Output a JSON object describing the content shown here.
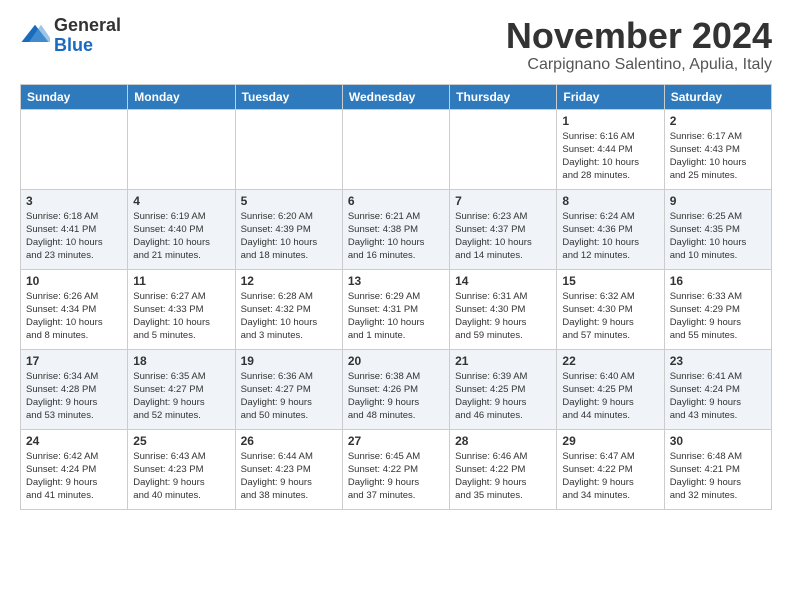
{
  "header": {
    "logo_line1": "General",
    "logo_line2": "Blue",
    "month": "November 2024",
    "location": "Carpignano Salentino, Apulia, Italy"
  },
  "weekdays": [
    "Sunday",
    "Monday",
    "Tuesday",
    "Wednesday",
    "Thursday",
    "Friday",
    "Saturday"
  ],
  "weeks": [
    [
      {
        "day": "",
        "info": ""
      },
      {
        "day": "",
        "info": ""
      },
      {
        "day": "",
        "info": ""
      },
      {
        "day": "",
        "info": ""
      },
      {
        "day": "",
        "info": ""
      },
      {
        "day": "1",
        "info": "Sunrise: 6:16 AM\nSunset: 4:44 PM\nDaylight: 10 hours\nand 28 minutes."
      },
      {
        "day": "2",
        "info": "Sunrise: 6:17 AM\nSunset: 4:43 PM\nDaylight: 10 hours\nand 25 minutes."
      }
    ],
    [
      {
        "day": "3",
        "info": "Sunrise: 6:18 AM\nSunset: 4:41 PM\nDaylight: 10 hours\nand 23 minutes."
      },
      {
        "day": "4",
        "info": "Sunrise: 6:19 AM\nSunset: 4:40 PM\nDaylight: 10 hours\nand 21 minutes."
      },
      {
        "day": "5",
        "info": "Sunrise: 6:20 AM\nSunset: 4:39 PM\nDaylight: 10 hours\nand 18 minutes."
      },
      {
        "day": "6",
        "info": "Sunrise: 6:21 AM\nSunset: 4:38 PM\nDaylight: 10 hours\nand 16 minutes."
      },
      {
        "day": "7",
        "info": "Sunrise: 6:23 AM\nSunset: 4:37 PM\nDaylight: 10 hours\nand 14 minutes."
      },
      {
        "day": "8",
        "info": "Sunrise: 6:24 AM\nSunset: 4:36 PM\nDaylight: 10 hours\nand 12 minutes."
      },
      {
        "day": "9",
        "info": "Sunrise: 6:25 AM\nSunset: 4:35 PM\nDaylight: 10 hours\nand 10 minutes."
      }
    ],
    [
      {
        "day": "10",
        "info": "Sunrise: 6:26 AM\nSunset: 4:34 PM\nDaylight: 10 hours\nand 8 minutes."
      },
      {
        "day": "11",
        "info": "Sunrise: 6:27 AM\nSunset: 4:33 PM\nDaylight: 10 hours\nand 5 minutes."
      },
      {
        "day": "12",
        "info": "Sunrise: 6:28 AM\nSunset: 4:32 PM\nDaylight: 10 hours\nand 3 minutes."
      },
      {
        "day": "13",
        "info": "Sunrise: 6:29 AM\nSunset: 4:31 PM\nDaylight: 10 hours\nand 1 minute."
      },
      {
        "day": "14",
        "info": "Sunrise: 6:31 AM\nSunset: 4:30 PM\nDaylight: 9 hours\nand 59 minutes."
      },
      {
        "day": "15",
        "info": "Sunrise: 6:32 AM\nSunset: 4:30 PM\nDaylight: 9 hours\nand 57 minutes."
      },
      {
        "day": "16",
        "info": "Sunrise: 6:33 AM\nSunset: 4:29 PM\nDaylight: 9 hours\nand 55 minutes."
      }
    ],
    [
      {
        "day": "17",
        "info": "Sunrise: 6:34 AM\nSunset: 4:28 PM\nDaylight: 9 hours\nand 53 minutes."
      },
      {
        "day": "18",
        "info": "Sunrise: 6:35 AM\nSunset: 4:27 PM\nDaylight: 9 hours\nand 52 minutes."
      },
      {
        "day": "19",
        "info": "Sunrise: 6:36 AM\nSunset: 4:27 PM\nDaylight: 9 hours\nand 50 minutes."
      },
      {
        "day": "20",
        "info": "Sunrise: 6:38 AM\nSunset: 4:26 PM\nDaylight: 9 hours\nand 48 minutes."
      },
      {
        "day": "21",
        "info": "Sunrise: 6:39 AM\nSunset: 4:25 PM\nDaylight: 9 hours\nand 46 minutes."
      },
      {
        "day": "22",
        "info": "Sunrise: 6:40 AM\nSunset: 4:25 PM\nDaylight: 9 hours\nand 44 minutes."
      },
      {
        "day": "23",
        "info": "Sunrise: 6:41 AM\nSunset: 4:24 PM\nDaylight: 9 hours\nand 43 minutes."
      }
    ],
    [
      {
        "day": "24",
        "info": "Sunrise: 6:42 AM\nSunset: 4:24 PM\nDaylight: 9 hours\nand 41 minutes."
      },
      {
        "day": "25",
        "info": "Sunrise: 6:43 AM\nSunset: 4:23 PM\nDaylight: 9 hours\nand 40 minutes."
      },
      {
        "day": "26",
        "info": "Sunrise: 6:44 AM\nSunset: 4:23 PM\nDaylight: 9 hours\nand 38 minutes."
      },
      {
        "day": "27",
        "info": "Sunrise: 6:45 AM\nSunset: 4:22 PM\nDaylight: 9 hours\nand 37 minutes."
      },
      {
        "day": "28",
        "info": "Sunrise: 6:46 AM\nSunset: 4:22 PM\nDaylight: 9 hours\nand 35 minutes."
      },
      {
        "day": "29",
        "info": "Sunrise: 6:47 AM\nSunset: 4:22 PM\nDaylight: 9 hours\nand 34 minutes."
      },
      {
        "day": "30",
        "info": "Sunrise: 6:48 AM\nSunset: 4:21 PM\nDaylight: 9 hours\nand 32 minutes."
      }
    ]
  ]
}
